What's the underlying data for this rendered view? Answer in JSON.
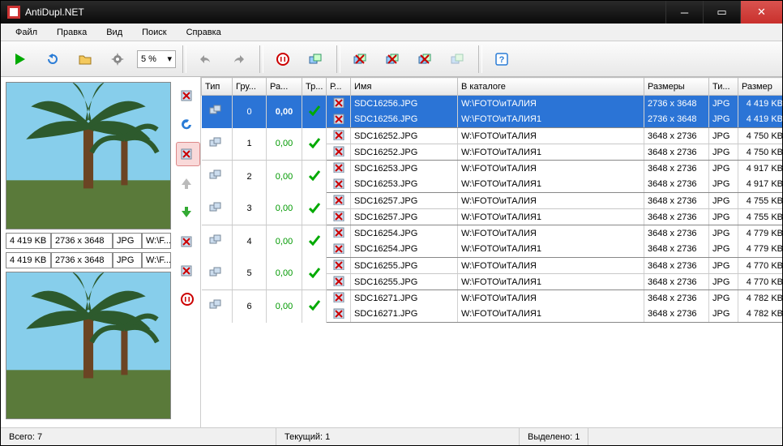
{
  "window": {
    "title": "AntiDupl.NET"
  },
  "menu": {
    "file": "Файл",
    "edit": "Правка",
    "view": "Вид",
    "search": "Поиск",
    "help": "Справка"
  },
  "toolbar": {
    "percent": "5 %"
  },
  "preview": {
    "top": {
      "size": "4 419 KB",
      "dims": "2736 x 3648",
      "type": "JPG",
      "catalog": "W:\\F..."
    },
    "bottom": {
      "size": "4 419 KB",
      "dims": "2736 x 3648",
      "type": "JPG",
      "catalog": "W:\\F..."
    }
  },
  "columns": {
    "type": "Тип",
    "group": "Гру...",
    "diff": "Ра...",
    "tr": "Тр...",
    "r": "Р...",
    "name": "Имя",
    "catalog": "В каталоге",
    "dims": "Размеры",
    "typ": "Ти...",
    "size": "Размер"
  },
  "rows": [
    {
      "sel": true,
      "group": "0",
      "diff": "0,00",
      "a": {
        "name": "SDC16256.JPG",
        "catalog": "W:\\FOTO\\иТАЛИЯ",
        "dims": "2736 x 3648",
        "type": "JPG",
        "size": "4 419 KB"
      },
      "b": {
        "name": "SDC16256.JPG",
        "catalog": "W:\\FOTO\\иТАЛИЯ1",
        "dims": "2736 x 3648",
        "type": "JPG",
        "size": "4 419 KB"
      }
    },
    {
      "sel": false,
      "group": "1",
      "diff": "0,00",
      "a": {
        "name": "SDC16252.JPG",
        "catalog": "W:\\FOTO\\иТАЛИЯ",
        "dims": "3648 x 2736",
        "type": "JPG",
        "size": "4 750 KB"
      },
      "b": {
        "name": "SDC16252.JPG",
        "catalog": "W:\\FOTO\\иТАЛИЯ1",
        "dims": "3648 x 2736",
        "type": "JPG",
        "size": "4 750 KB"
      }
    },
    {
      "sel": false,
      "group": "2",
      "diff": "0,00",
      "a": {
        "name": "SDC16253.JPG",
        "catalog": "W:\\FOTO\\иТАЛИЯ",
        "dims": "3648 x 2736",
        "type": "JPG",
        "size": "4 917 KB"
      },
      "b": {
        "name": "SDC16253.JPG",
        "catalog": "W:\\FOTO\\иТАЛИЯ1",
        "dims": "3648 x 2736",
        "type": "JPG",
        "size": "4 917 KB"
      }
    },
    {
      "sel": false,
      "group": "3",
      "diff": "0,00",
      "a": {
        "name": "SDC16257.JPG",
        "catalog": "W:\\FOTO\\иТАЛИЯ",
        "dims": "3648 x 2736",
        "type": "JPG",
        "size": "4 755 KB"
      },
      "b": {
        "name": "SDC16257.JPG",
        "catalog": "W:\\FOTO\\иТАЛИЯ1",
        "dims": "3648 x 2736",
        "type": "JPG",
        "size": "4 755 KB"
      }
    },
    {
      "sel": false,
      "group": "4",
      "diff": "0,00",
      "a": {
        "name": "SDC16254.JPG",
        "catalog": "W:\\FOTO\\иТАЛИЯ",
        "dims": "3648 x 2736",
        "type": "JPG",
        "size": "4 779 KB"
      },
      "b": {
        "name": "SDC16254.JPG",
        "catalog": "W:\\FOTO\\иТАЛИЯ1",
        "dims": "3648 x 2736",
        "type": "JPG",
        "size": "4 779 KB"
      }
    },
    {
      "sel": false,
      "group": "5",
      "diff": "0,00",
      "a": {
        "name": "SDC16255.JPG",
        "catalog": "W:\\FOTO\\иТАЛИЯ",
        "dims": "3648 x 2736",
        "type": "JPG",
        "size": "4 770 KB"
      },
      "b": {
        "name": "SDC16255.JPG",
        "catalog": "W:\\FOTO\\иТАЛИЯ1",
        "dims": "3648 x 2736",
        "type": "JPG",
        "size": "4 770 KB"
      }
    },
    {
      "sel": false,
      "group": "6",
      "diff": "0,00",
      "a": {
        "name": "SDC16271.JPG",
        "catalog": "W:\\FOTO\\иТАЛИЯ",
        "dims": "3648 x 2736",
        "type": "JPG",
        "size": "4 782 KB"
      },
      "b": {
        "name": "SDC16271.JPG",
        "catalog": "W:\\FOTO\\иТАЛИЯ1",
        "dims": "3648 x 2736",
        "type": "JPG",
        "size": "4 782 KB"
      }
    }
  ],
  "status": {
    "total": "Всего: 7",
    "current": "Текущий: 1",
    "selected": "Выделено: 1"
  }
}
